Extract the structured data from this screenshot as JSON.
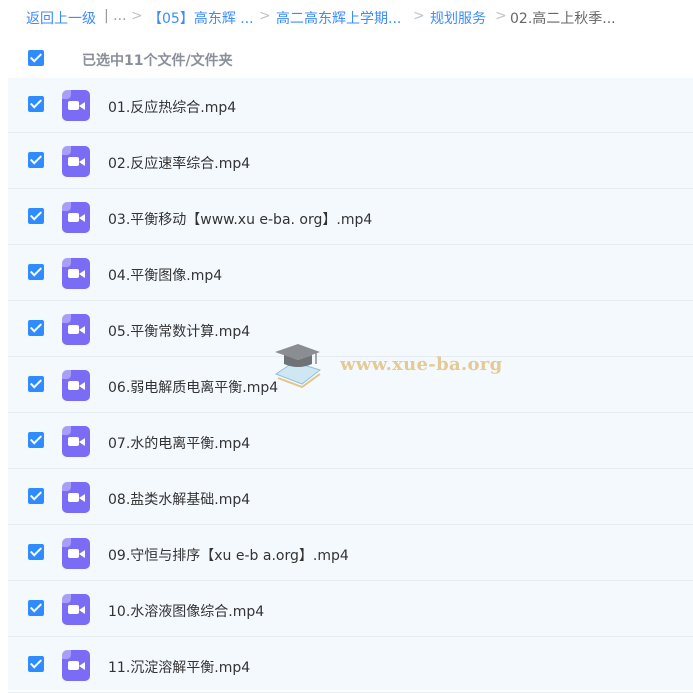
{
  "breadcrumb": {
    "back": "返回上一级",
    "ellipsis": "| ...",
    "sep": ">",
    "crumbs": [
      "【05】高东辉 ...",
      "高二高东辉上学期...",
      "规划服务"
    ],
    "current": "02.高二上秋季..."
  },
  "selection": {
    "label": "已选中11个文件/文件夹",
    "checked": true
  },
  "files": [
    {
      "name": "01.反应热综合.mp4",
      "checked": true,
      "icon": "video-file-icon"
    },
    {
      "name": "02.反应速率综合.mp4",
      "checked": true,
      "icon": "video-file-icon"
    },
    {
      "name": "03.平衡移动【www.xu e-ba. org】.mp4",
      "checked": true,
      "icon": "video-file-icon"
    },
    {
      "name": "04.平衡图像.mp4",
      "checked": true,
      "icon": "video-file-icon"
    },
    {
      "name": "05.平衡常数计算.mp4",
      "checked": true,
      "icon": "video-file-icon"
    },
    {
      "name": "06.弱电解质电离平衡.mp4",
      "checked": true,
      "icon": "video-file-icon"
    },
    {
      "name": "07.水的电离平衡.mp4",
      "checked": true,
      "icon": "video-file-icon"
    },
    {
      "name": "08.盐类水解基础.mp4",
      "checked": true,
      "icon": "video-file-icon"
    },
    {
      "name": "09.守恒与排序【xu e-b a.org】.mp4",
      "checked": true,
      "icon": "video-file-icon"
    },
    {
      "name": "10.水溶液图像综合.mp4",
      "checked": true,
      "icon": "video-file-icon"
    },
    {
      "name": "11.沉淀溶解平衡.mp4",
      "checked": true,
      "icon": "video-file-icon"
    }
  ],
  "watermark": {
    "text": "www.xue-ba.org",
    "icon": "graduation-cap-icon"
  },
  "colors": {
    "link": "#3b8cff",
    "checkbox": "#2f8cff",
    "file_icon": "#7b6cf5",
    "list_bg": "#f4f9fd"
  }
}
